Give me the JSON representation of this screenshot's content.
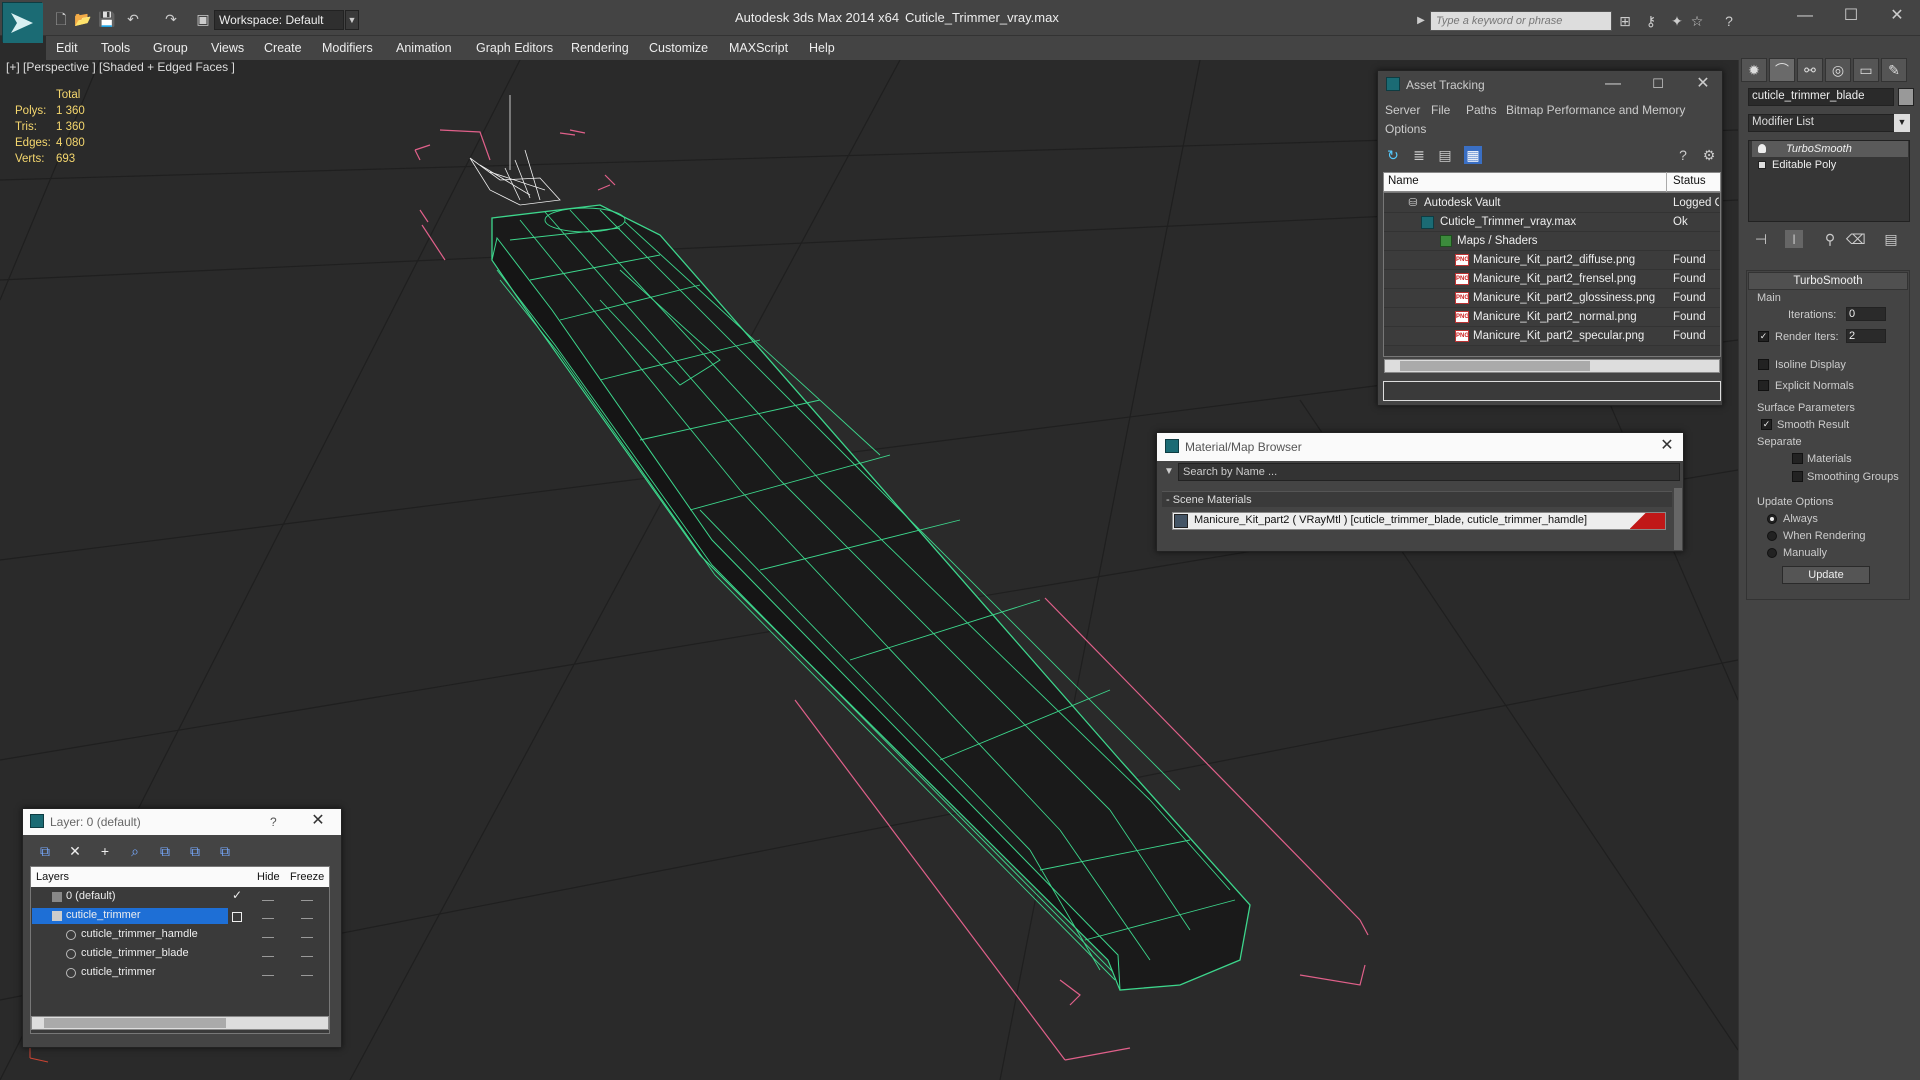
{
  "titlebar": {
    "workspace": "Workspace: Default",
    "app_title": "Autodesk 3ds Max  2014 x64",
    "file_title": "Cuticle_Trimmer_vray.max",
    "search_placeholder": "Type a keyword or phrase"
  },
  "menu": [
    "Edit",
    "Tools",
    "Group",
    "Views",
    "Create",
    "Modifiers",
    "Animation",
    "Graph Editors",
    "Rendering",
    "Customize",
    "MAXScript",
    "Help"
  ],
  "viewport": {
    "label": "[+] [Perspective ] [Shaded + Edged Faces ]",
    "stats_header": "Total",
    "stats": [
      {
        "label": "Polys:",
        "value": "1 360"
      },
      {
        "label": "Tris:",
        "value": "1 360"
      },
      {
        "label": "Edges:",
        "value": "4 080"
      },
      {
        "label": "Verts:",
        "value": "693"
      }
    ]
  },
  "command_panel": {
    "object_name": "cuticle_trimmer_blade",
    "modifier_list": "Modifier List",
    "stack": [
      "TurboSmooth",
      "Editable Poly"
    ],
    "rollout_title": "TurboSmooth",
    "main_group": "Main",
    "iterations_label": "Iterations:",
    "iterations_value": "0",
    "render_iters_label": "Render Iters:",
    "render_iters_value": "2",
    "isoline": "Isoline Display",
    "explicit_normals": "Explicit Normals",
    "surface_params": "Surface Parameters",
    "smooth_result": "Smooth Result",
    "separate": "Separate",
    "materials": "Materials",
    "smoothing_groups": "Smoothing Groups",
    "update_options": "Update Options",
    "always": "Always",
    "when_rendering": "When Rendering",
    "manually": "Manually",
    "update_button": "Update"
  },
  "asset_tracking": {
    "title": "Asset Tracking",
    "menu": [
      "Server",
      "File",
      "Paths",
      "Bitmap Performance and Memory"
    ],
    "menu2": "Options",
    "col_name": "Name",
    "col_status": "Status",
    "rows": [
      {
        "name": "Autodesk Vault",
        "status": "Logged O"
      },
      {
        "name": "Cuticle_Trimmer_vray.max",
        "status": "Ok"
      },
      {
        "name": "Maps / Shaders",
        "status": ""
      },
      {
        "name": "Manicure_Kit_part2_diffuse.png",
        "status": "Found"
      },
      {
        "name": "Manicure_Kit_part2_frensel.png",
        "status": "Found"
      },
      {
        "name": "Manicure_Kit_part2_glossiness.png",
        "status": "Found"
      },
      {
        "name": "Manicure_Kit_part2_normal.png",
        "status": "Found"
      },
      {
        "name": "Manicure_Kit_part2_specular.png",
        "status": "Found"
      }
    ],
    "png_badge": "PNG"
  },
  "material_browser": {
    "title": "Material/Map Browser",
    "search_placeholder": "Search by Name ...",
    "section": "- Scene Materials",
    "material": "Manicure_Kit_part2  ( VRayMtl ) [cuticle_trimmer_blade, cuticle_trimmer_hamdle]"
  },
  "layer_panel": {
    "title": "Layer: 0 (default)",
    "help": "?",
    "col_layers": "Layers",
    "col_hide": "Hide",
    "col_freeze": "Freeze",
    "rows": [
      "0 (default)",
      "cuticle_trimmer",
      "cuticle_trimmer_hamdle",
      "cuticle_trimmer_blade",
      "cuticle_trimmer"
    ]
  },
  "colors": {
    "wire_green": "#3dd68c",
    "gizmo_pink": "#e0608a",
    "selection_blue": "#1e6fd6",
    "material_red": "#c01818"
  }
}
